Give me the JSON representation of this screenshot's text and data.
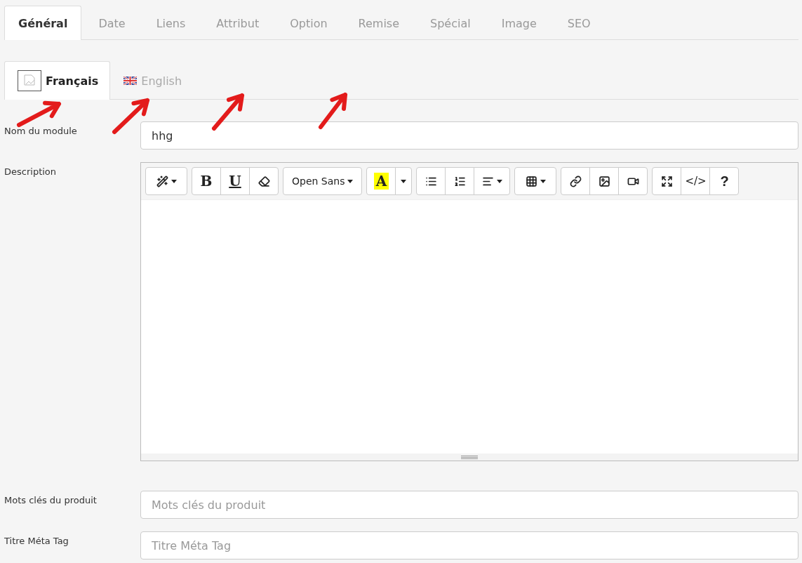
{
  "tabs": [
    {
      "label": "Général",
      "selected": true
    },
    {
      "label": "Date",
      "selected": false
    },
    {
      "label": "Liens",
      "selected": false
    },
    {
      "label": "Attribut",
      "selected": false
    },
    {
      "label": "Option",
      "selected": false
    },
    {
      "label": "Remise",
      "selected": false
    },
    {
      "label": "Spécial",
      "selected": false
    },
    {
      "label": "Image",
      "selected": false
    },
    {
      "label": "SEO",
      "selected": false
    }
  ],
  "language_tabs": [
    {
      "label": "Français",
      "selected": true,
      "kind": "missing-image"
    },
    {
      "label": "English",
      "selected": false,
      "kind": "uk-flag"
    }
  ],
  "form": [
    {
      "kind": "input",
      "label": "Nom du module",
      "value": "hhg"
    },
    {
      "kind": "editor",
      "label": "Description",
      "toolbar": [
        [
          {
            "kind": "style"
          }
        ],
        [
          {
            "kind": "bold",
            "label": "B"
          },
          {
            "kind": "underline",
            "label": "U"
          },
          {
            "kind": "eraser"
          }
        ],
        [
          {
            "kind": "font",
            "label": "Open Sans"
          }
        ],
        [
          {
            "kind": "color",
            "label": "A"
          },
          {
            "kind": "caret"
          }
        ],
        [
          {
            "kind": "ul"
          },
          {
            "kind": "ol"
          },
          {
            "kind": "align"
          }
        ],
        [
          {
            "kind": "table"
          }
        ],
        [
          {
            "kind": "link"
          },
          {
            "kind": "picture"
          },
          {
            "kind": "video"
          }
        ],
        [
          {
            "kind": "fullscreen"
          },
          {
            "kind": "code",
            "label": "</>"
          },
          {
            "kind": "help",
            "label": "?"
          }
        ]
      ]
    },
    {
      "kind": "input",
      "label": "Mots clés du produit",
      "placeholder": "Mots clés du produit"
    },
    {
      "kind": "input",
      "label": "Titre Méta Tag",
      "placeholder": "Titre Méta Tag"
    }
  ]
}
